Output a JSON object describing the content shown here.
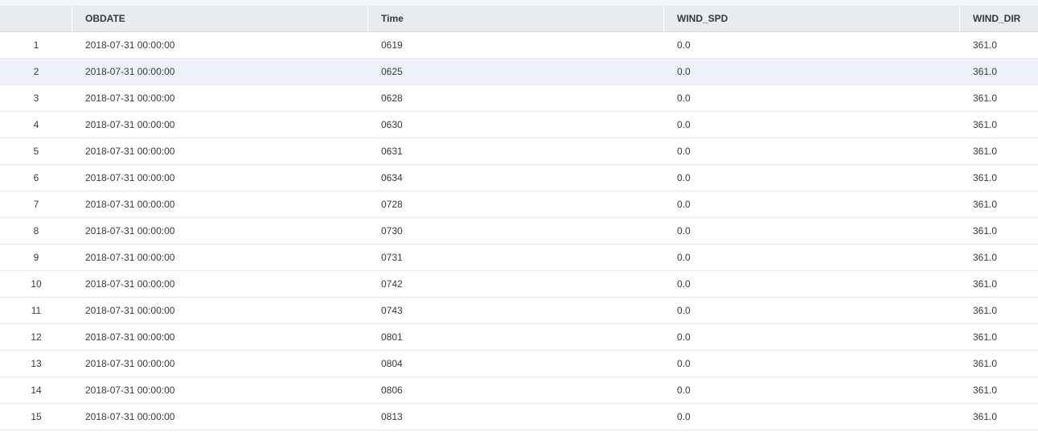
{
  "table": {
    "columns": [
      "",
      "OBDATE",
      "Time",
      "WIND_SPD",
      "WIND_DIR"
    ],
    "selected_row": 1,
    "rows": [
      [
        "1",
        "2018-07-31 00:00:00",
        "0619",
        "0.0",
        "361.0"
      ],
      [
        "2",
        "2018-07-31 00:00:00",
        "0625",
        "0.0",
        "361.0"
      ],
      [
        "3",
        "2018-07-31 00:00:00",
        "0628",
        "0.0",
        "361.0"
      ],
      [
        "4",
        "2018-07-31 00:00:00",
        "0630",
        "0.0",
        "361.0"
      ],
      [
        "5",
        "2018-07-31 00:00:00",
        "0631",
        "0.0",
        "361.0"
      ],
      [
        "6",
        "2018-07-31 00:00:00",
        "0634",
        "0.0",
        "361.0"
      ],
      [
        "7",
        "2018-07-31 00:00:00",
        "0728",
        "0.0",
        "361.0"
      ],
      [
        "8",
        "2018-07-31 00:00:00",
        "0730",
        "0.0",
        "361.0"
      ],
      [
        "9",
        "2018-07-31 00:00:00",
        "0731",
        "0.0",
        "361.0"
      ],
      [
        "10",
        "2018-07-31 00:00:00",
        "0742",
        "0.0",
        "361.0"
      ],
      [
        "11",
        "2018-07-31 00:00:00",
        "0743",
        "0.0",
        "361.0"
      ],
      [
        "12",
        "2018-07-31 00:00:00",
        "0801",
        "0.0",
        "361.0"
      ],
      [
        "13",
        "2018-07-31 00:00:00",
        "0804",
        "0.0",
        "361.0"
      ],
      [
        "14",
        "2018-07-31 00:00:00",
        "0806",
        "0.0",
        "361.0"
      ],
      [
        "15",
        "2018-07-31 00:00:00",
        "0813",
        "0.0",
        "361.0"
      ]
    ]
  }
}
